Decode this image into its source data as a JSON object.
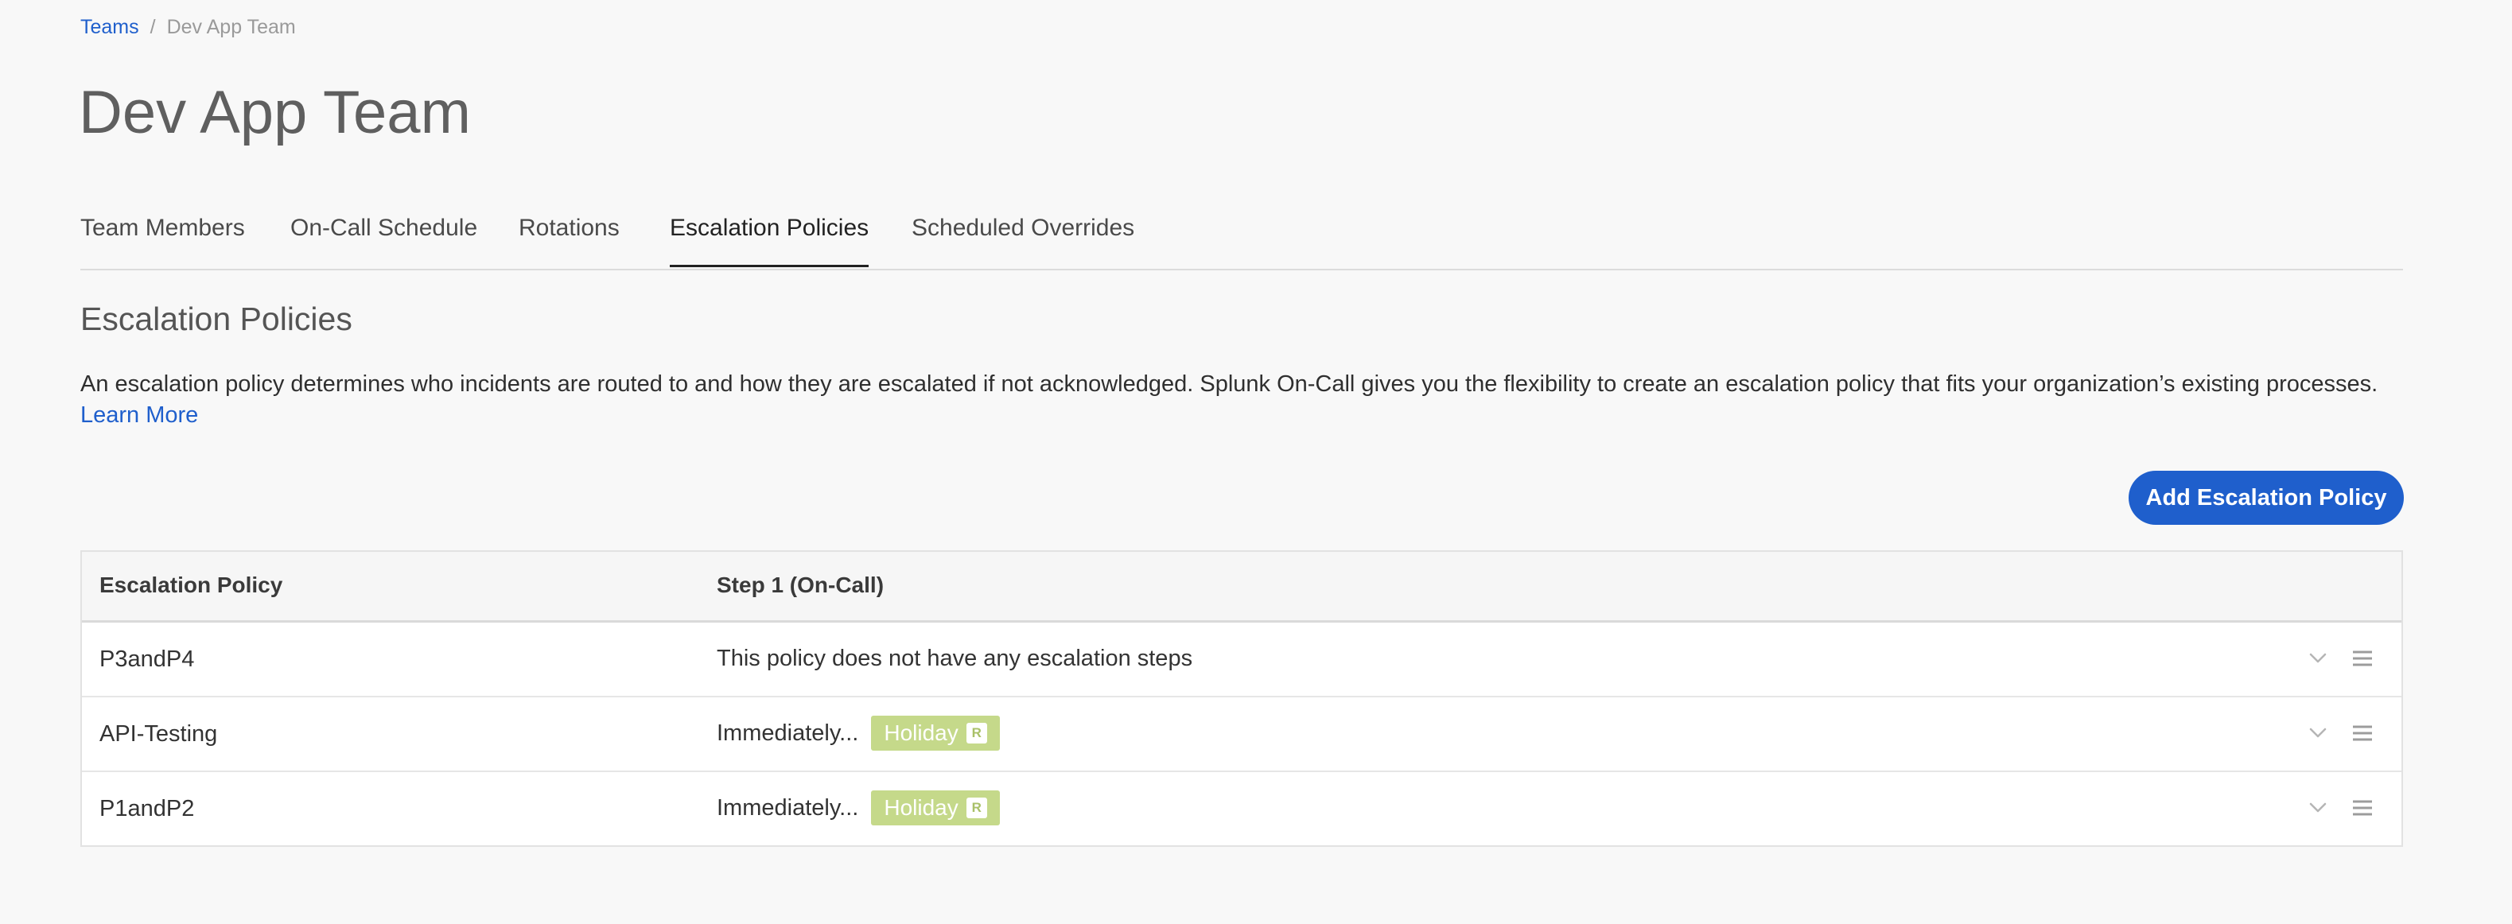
{
  "breadcrumb": {
    "parent": "Teams",
    "separator": "/",
    "current": "Dev App Team"
  },
  "page_title": "Dev App Team",
  "tabs": [
    {
      "label": "Team Members"
    },
    {
      "label": "On-Call Schedule"
    },
    {
      "label": "Rotations"
    },
    {
      "label": "Escalation Policies",
      "active": true
    },
    {
      "label": "Scheduled Overrides"
    }
  ],
  "section": {
    "title": "Escalation Policies",
    "description": "An escalation policy determines who incidents are routed to and how they are escalated if not acknowledged. Splunk On-Call gives you the flexibility to create an escalation policy that fits your organization’s existing processes. ",
    "learn_more": "Learn More"
  },
  "add_button": "Add Escalation Policy",
  "table": {
    "headers": {
      "policy": "Escalation Policy",
      "step": "Step 1 (On-Call)"
    },
    "rows": [
      {
        "name": "P3andP4",
        "step_text": "This policy does not have any escalation steps"
      },
      {
        "name": "API-Testing",
        "step_text": "Immediately...",
        "badge": "Holiday",
        "badge_marker": "R"
      },
      {
        "name": "P1andP2",
        "step_text": "Immediately...",
        "badge": "Holiday",
        "badge_marker": "R"
      }
    ]
  },
  "icons": {
    "row_expand": "chevron-down-icon",
    "row_menu": "hamburger-menu-icon"
  },
  "colors": {
    "accent": "#1f5fcc",
    "badge": "#c5d98a",
    "background": "#f8f8f8"
  }
}
